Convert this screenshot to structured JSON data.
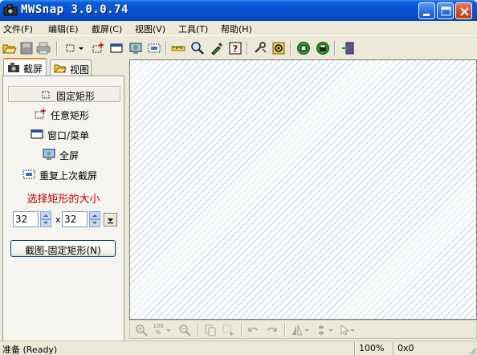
{
  "window": {
    "title": "MWSnap  3.0.0.74",
    "controls": {
      "minimize": "minimize-icon",
      "maximize": "maximize-icon",
      "close": "close-icon"
    }
  },
  "menu": [
    {
      "label": "文件(F)"
    },
    {
      "label": "编辑(E)"
    },
    {
      "label": "截屏(C)"
    },
    {
      "label": "视图(V)"
    },
    {
      "label": "工具(T)"
    },
    {
      "label": "帮助(H)"
    }
  ],
  "toolbar": {
    "icons": [
      "open-folder-icon",
      "save-icon",
      "print-icon",
      "fixed-rect-icon",
      "dropdown-arrow-icon",
      "any-rect-icon",
      "window-menu-icon",
      "fullscreen-icon",
      "repeat-last-icon",
      "ruler-icon",
      "zoom-icon",
      "color-picker-icon",
      "help-icon",
      "wrench-icon",
      "settings-icon",
      "record-green-icon",
      "record-black-icon",
      "exit-icon"
    ]
  },
  "tabs": [
    {
      "label": "截屏",
      "icon": "camera-icon",
      "active": true
    },
    {
      "label": "视图",
      "icon": "open-folder-icon",
      "active": false
    }
  ],
  "capture_panel": {
    "actions": [
      {
        "label": "固定矩形",
        "icon": "fixed-rect-icon",
        "selected": true
      },
      {
        "label": "任意矩形",
        "icon": "any-rect-icon",
        "selected": false
      },
      {
        "label": "窗口/菜单",
        "icon": "window-menu-icon",
        "selected": false
      },
      {
        "label": "全屏",
        "icon": "fullscreen-icon",
        "selected": false
      },
      {
        "label": "重复上次截屏",
        "icon": "repeat-last-icon",
        "selected": false
      }
    ],
    "size_title": "选择矩形的大小",
    "width_value": "32",
    "height_value": "32",
    "x_separator": "x",
    "capture_button": "截图-固定矩形(N)",
    "title_color": "#c00000"
  },
  "canvas_toolbar": {
    "icons": [
      "zoom-in-icon",
      "zoom-percent-icon",
      "zoom-out-icon",
      "copy-icon",
      "crop-icon",
      "undo-icon",
      "redo-icon",
      "flip-icon",
      "align-icon",
      "cursor-icon"
    ],
    "zoom_label": "100 %"
  },
  "status": {
    "message": "准备 (Ready)",
    "zoom": "100%",
    "size": "0x0"
  },
  "colors": {
    "title_bar": "#0a52cf",
    "canvas_stripe": "#b7d3dc",
    "tab_accent": "#e68b2c",
    "button_border": "#003c74"
  }
}
